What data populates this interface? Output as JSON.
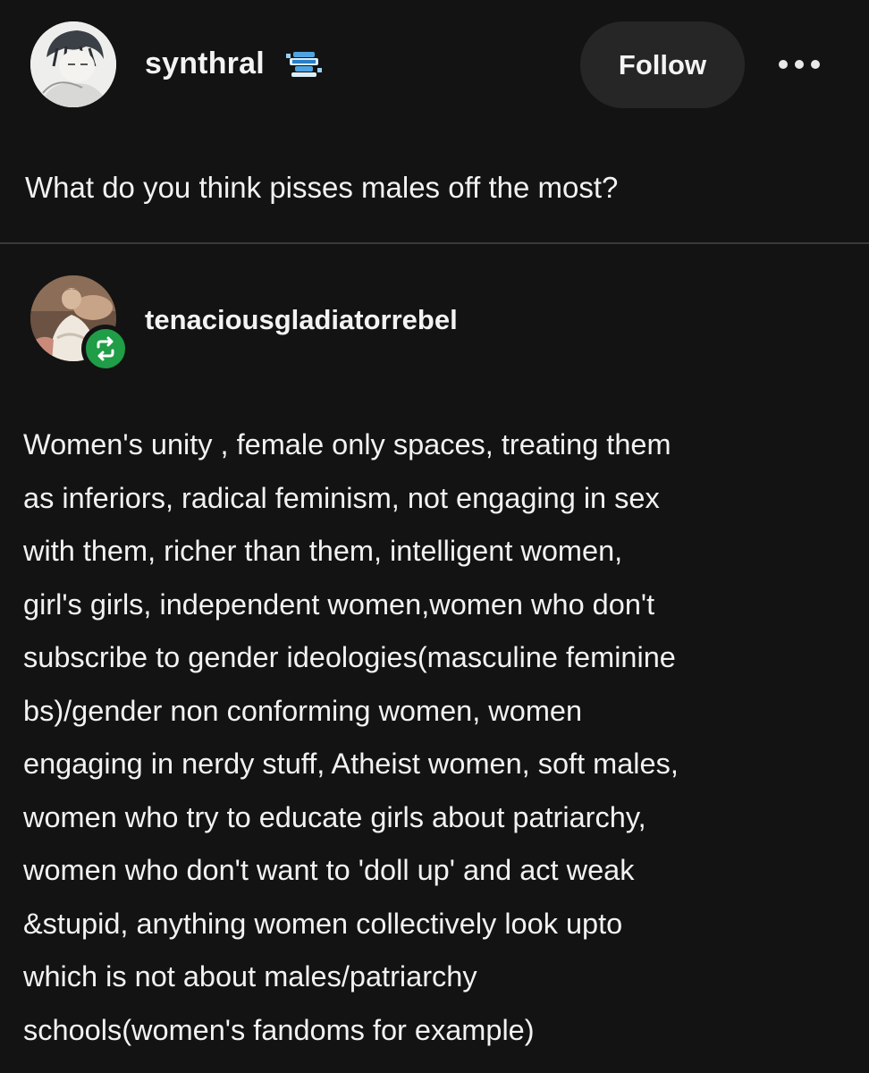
{
  "post": {
    "author": {
      "username": "synthral",
      "badge_icon": "robot-badge-icon"
    },
    "follow_label": "Follow",
    "more_icon": "more-options-icon",
    "question": "What do you think pisses males off the most?"
  },
  "reblog": {
    "username": "tenaciousgladiatorrebel",
    "reblog_icon": "reblog-icon",
    "reblog_color": "#1f9d47",
    "answer_lines": [
      "Women's unity , female only spaces, treating them",
      "as inferiors, radical feminism, not engaging in sex",
      "with them, richer than them, intelligent women,",
      "girl's girls, independent women,women who don't",
      "subscribe to gender ideologies(masculine feminine",
      "bs)/gender non conforming women, women",
      "engaging in nerdy stuff, Atheist women, soft males,",
      "women who try to educate girls about patriarchy,",
      "women who don't want to 'doll up' and act weak",
      "&stupid, anything women collectively look upto",
      "which is not about males/patriarchy",
      "schools(women's fandoms for example)"
    ]
  },
  "colors": {
    "background": "#131313",
    "button_bg": "#262626",
    "text": "#f2f2f2",
    "divider": "#3a3a3a"
  }
}
